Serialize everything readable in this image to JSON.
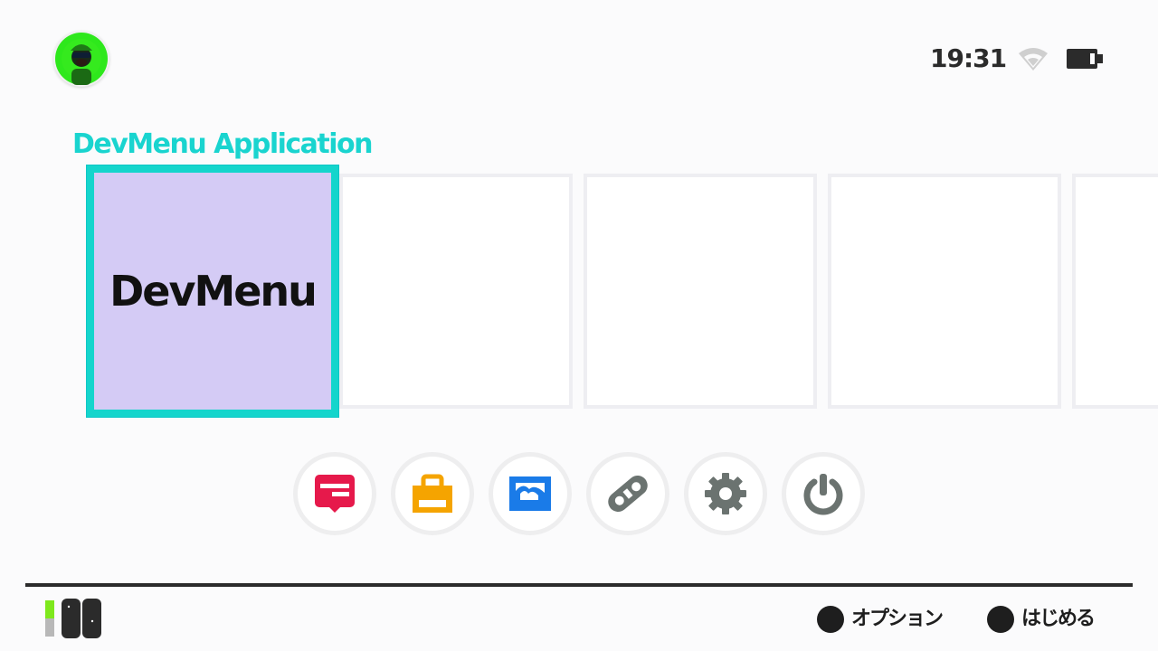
{
  "header": {
    "time": "19:31"
  },
  "icons": {
    "avatar": "user-avatar-icon",
    "wifi": "wifi-icon",
    "battery": "battery-icon",
    "news": "news-icon",
    "shop": "shop-icon",
    "album": "album-icon",
    "controllers": "controllers-icon",
    "settings": "settings-icon",
    "power": "power-icon",
    "joycon": "joycon-icon"
  },
  "section": {
    "title": "DevMenu Application"
  },
  "tiles": [
    {
      "label": "DevMenu",
      "selected": true
    },
    {
      "label": ""
    },
    {
      "label": ""
    },
    {
      "label": ""
    },
    {
      "label": ""
    }
  ],
  "footer": {
    "hints": [
      {
        "label": "オプション"
      },
      {
        "label": "はじめる"
      }
    ]
  },
  "colors": {
    "accent": "#14d5cc",
    "selected_tile_bg": "#d4cbf5",
    "background": "#fbfbfc",
    "news_red": "#e6194b",
    "shop_orange": "#f5a400",
    "album_blue": "#1a7be8",
    "gray_icon": "#6b7370"
  }
}
